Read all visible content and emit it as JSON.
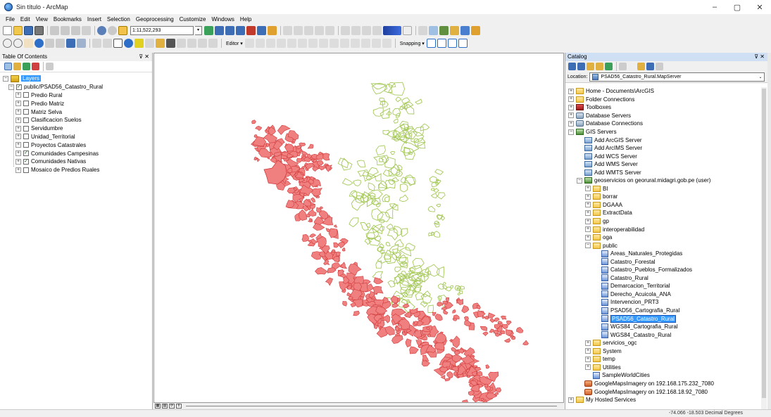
{
  "window": {
    "title": "Sin título - ArcMap",
    "controls": [
      "–",
      "▢",
      "✕"
    ]
  },
  "menu": [
    "File",
    "Edit",
    "View",
    "Bookmarks",
    "Insert",
    "Selection",
    "Geoprocessing",
    "Customize",
    "Windows",
    "Help"
  ],
  "toolbar": {
    "scale": "1:11,522,293",
    "editor_label": "Editor ▾",
    "snapping_label": "Snapping ▾"
  },
  "toc": {
    "title": "Table Of Contents",
    "pin": "⊽ ✕",
    "root": "Layers",
    "group": "public/PSAD56_Catastro_Rural",
    "layers": [
      {
        "label": "Predio Rural",
        "checked": false
      },
      {
        "label": "Predio Matriz",
        "checked": false
      },
      {
        "label": "Matriz Selva",
        "checked": false
      },
      {
        "label": "Clasificacion Suelos",
        "checked": false
      },
      {
        "label": "Servidumbre",
        "checked": false
      },
      {
        "label": "Unidad_Territorial",
        "checked": false
      },
      {
        "label": "Proyectos Catastrales",
        "checked": false
      },
      {
        "label": "Comunidades Campesinas",
        "checked": true
      },
      {
        "label": "Comunidades Nativas",
        "checked": true
      },
      {
        "label": "Mosaico de Predios Ruales",
        "checked": false
      }
    ]
  },
  "map": {
    "colors": {
      "campesinas_fill": "#f08080",
      "campesinas_stroke": "#d03a3a",
      "nativas_stroke": "#a6c95a"
    }
  },
  "catalog": {
    "title": "Catalog",
    "pin": "⊽ ✕",
    "location_label": "Location:",
    "location_value": "PSAD56_Catastro_Rural.MapServer",
    "tree": [
      {
        "level": 0,
        "exp": "+",
        "icon": "home",
        "label": "Home - Documents\\ArcGIS"
      },
      {
        "level": 0,
        "exp": "+",
        "icon": "folder",
        "label": "Folder Connections"
      },
      {
        "level": 0,
        "exp": "+",
        "icon": "toolbox",
        "label": "Toolboxes"
      },
      {
        "level": 0,
        "exp": "+",
        "icon": "db",
        "label": "Database Servers"
      },
      {
        "level": 0,
        "exp": "+",
        "icon": "db",
        "label": "Database Connections"
      },
      {
        "level": 0,
        "exp": "−",
        "icon": "server",
        "label": "GIS Servers"
      },
      {
        "level": 1,
        "exp": "",
        "icon": "add",
        "label": "Add ArcGIS Server"
      },
      {
        "level": 1,
        "exp": "",
        "icon": "add",
        "label": "Add ArcIMS Server"
      },
      {
        "level": 1,
        "exp": "",
        "icon": "add",
        "label": "Add WCS Server"
      },
      {
        "level": 1,
        "exp": "",
        "icon": "add",
        "label": "Add WMS Server"
      },
      {
        "level": 1,
        "exp": "",
        "icon": "add",
        "label": "Add WMTS Server"
      },
      {
        "level": 1,
        "exp": "−",
        "icon": "server",
        "label": "geoservicios on georural.midagri.gob.pe (user)"
      },
      {
        "level": 2,
        "exp": "+",
        "icon": "folder",
        "label": "BI"
      },
      {
        "level": 2,
        "exp": "+",
        "icon": "folder",
        "label": "borrar"
      },
      {
        "level": 2,
        "exp": "+",
        "icon": "folder",
        "label": "DGAAA"
      },
      {
        "level": 2,
        "exp": "+",
        "icon": "folder",
        "label": "ExtractData"
      },
      {
        "level": 2,
        "exp": "+",
        "icon": "folder",
        "label": "gp"
      },
      {
        "level": 2,
        "exp": "+",
        "icon": "folder",
        "label": "interoperabilidad"
      },
      {
        "level": 2,
        "exp": "+",
        "icon": "folder",
        "label": "oga"
      },
      {
        "level": 2,
        "exp": "−",
        "icon": "folder",
        "label": "public"
      },
      {
        "level": 3,
        "exp": "",
        "icon": "service",
        "label": "Areas_Naturales_Protegidas"
      },
      {
        "level": 3,
        "exp": "",
        "icon": "service",
        "label": "Catastro_Forestal"
      },
      {
        "level": 3,
        "exp": "",
        "icon": "service",
        "label": "Catastro_Pueblos_Formalizados"
      },
      {
        "level": 3,
        "exp": "",
        "icon": "service",
        "label": "Catastro_Rural"
      },
      {
        "level": 3,
        "exp": "",
        "icon": "service",
        "label": "Demarcacion_Territorial"
      },
      {
        "level": 3,
        "exp": "",
        "icon": "service",
        "label": "Derecho_Acuicola_ANA"
      },
      {
        "level": 3,
        "exp": "",
        "icon": "service",
        "label": "Intervencion_PRT3"
      },
      {
        "level": 3,
        "exp": "",
        "icon": "service",
        "label": "PSAD56_Cartografia_Rural"
      },
      {
        "level": 3,
        "exp": "",
        "icon": "service",
        "label": "PSAD56_Catastro_Rural",
        "selected": true
      },
      {
        "level": 3,
        "exp": "",
        "icon": "service",
        "label": "WGS84_Cartografia_Rural"
      },
      {
        "level": 3,
        "exp": "",
        "icon": "service",
        "label": "WGS84_Catastro_Rural"
      },
      {
        "level": 2,
        "exp": "+",
        "icon": "folder",
        "label": "servicios_ogc"
      },
      {
        "level": 2,
        "exp": "+",
        "icon": "folder",
        "label": "System"
      },
      {
        "level": 2,
        "exp": "+",
        "icon": "folder",
        "label": "temp"
      },
      {
        "level": 2,
        "exp": "+",
        "icon": "folder",
        "label": "Utilities"
      },
      {
        "level": 2,
        "exp": "",
        "icon": "service",
        "label": "SampleWorldCities"
      },
      {
        "level": 1,
        "exp": "",
        "icon": "gmap",
        "label": "GoogleMapsImagery on 192.168.175.232_7080"
      },
      {
        "level": 1,
        "exp": "",
        "icon": "gmap",
        "label": "GoogleMapsImagery on 192.168.18.92_7080"
      },
      {
        "level": 0,
        "exp": "+",
        "icon": "folder",
        "label": "My Hosted Services"
      }
    ]
  },
  "status": {
    "coordinates": "-74.066  -18.503 Decimal Degrees"
  }
}
